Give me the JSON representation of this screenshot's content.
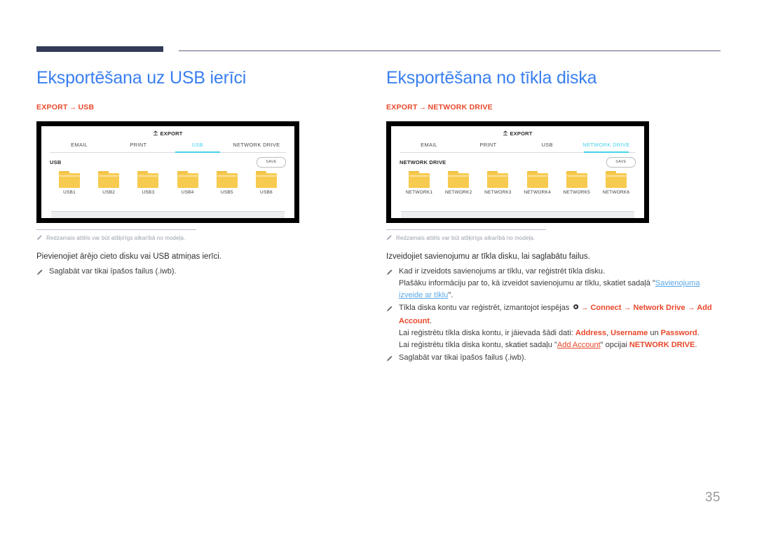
{
  "page": {
    "number": "35",
    "accent_blue": "#3a7ff0",
    "accent_red": "#e8472a",
    "accent_cyan": "#43d3ea",
    "rule_navy": "#323a56"
  },
  "left": {
    "heading": "Eksportēšana uz USB ierīci",
    "breadcrumb_from": "EXPORT",
    "breadcrumb_arrow": "→",
    "breadcrumb_to": "USB",
    "device": {
      "export_title": "EXPORT",
      "tabs": [
        {
          "label": "EMAIL",
          "active": false
        },
        {
          "label": "PRINT",
          "active": false
        },
        {
          "label": "USB",
          "active": true
        },
        {
          "label": "NETWORK DRIVE",
          "active": false
        }
      ],
      "drive_label": "USB",
      "save_label": "SAVE",
      "folders": [
        "USB1",
        "USB2",
        "USB3",
        "USB4",
        "USB5",
        "USB6"
      ]
    },
    "note": "Redzamais attēls var būt atšķirīgs atkarībā no modeļa.",
    "lead": "Pievienojiet ārējo cieto disku vai USB atmiņas ierīci.",
    "bullet_1": "Saglabāt var tikai īpašos failus (.iwb)."
  },
  "right": {
    "heading": "Eksportēšana no tīkla diska",
    "breadcrumb_from": "EXPORT",
    "breadcrumb_arrow": "→",
    "breadcrumb_to": "NETWORK DRIVE",
    "device": {
      "export_title": "EXPORT",
      "tabs": [
        {
          "label": "EMAIL",
          "active": false
        },
        {
          "label": "PRINT",
          "active": false
        },
        {
          "label": "USB",
          "active": false
        },
        {
          "label": "NETWORK DRIVE",
          "active": true
        }
      ],
      "drive_label": "NETWORK DRIVE",
      "save_label": "SAVE",
      "folders": [
        "NETWORK1",
        "NETWORK2",
        "NETWORK3",
        "NETWORK4",
        "NETWORK5",
        "NETWORK6"
      ]
    },
    "note": "Redzamais attēls var būt atšķirīgs atkarībā no modeļa.",
    "lead": "Izveidojiet savienojumu ar tīkla disku, lai saglabātu failus.",
    "bullet_1": {
      "line_1": "Kad ir izveidots savienojums ar tīklu, var reģistrēt tīkla disku.",
      "line_2_pre": "Plašāku informāciju par to, kā izveidot savienojumu ar tīklu, skatiet sadaļā \"",
      "line_2_link": "Savienojuma izveide ar tīklu",
      "line_2_post": "\"."
    },
    "bullet_2": {
      "line_1_pre": "Tīkla diska kontu var reģistrēt, izmantojot iespējas",
      "line_1_gear": "gear-icon",
      "line_1_path": "→ Connect → Network Drive → Add Account",
      "line_1_post": ".",
      "line_2_pre": "Lai reģistrētu tīkla diska kontu, ir jāievada šādi dati: ",
      "line_2_a": "Address",
      "line_2_sep1": ", ",
      "line_2_b": "Username",
      "line_2_sep2": " un ",
      "line_2_c": "Password",
      "line_2_post": ".",
      "line_3_pre": "Lai reģistrētu tīkla diska kontu, skatiet sadaļu \"",
      "line_3_link": "Add Account",
      "line_3_mid": "\" opcijai ",
      "line_3_bold": "NETWORK DRIVE",
      "line_3_post": "."
    },
    "bullet_3": "Saglabāt var tikai īpašos failus (.iwb)."
  }
}
